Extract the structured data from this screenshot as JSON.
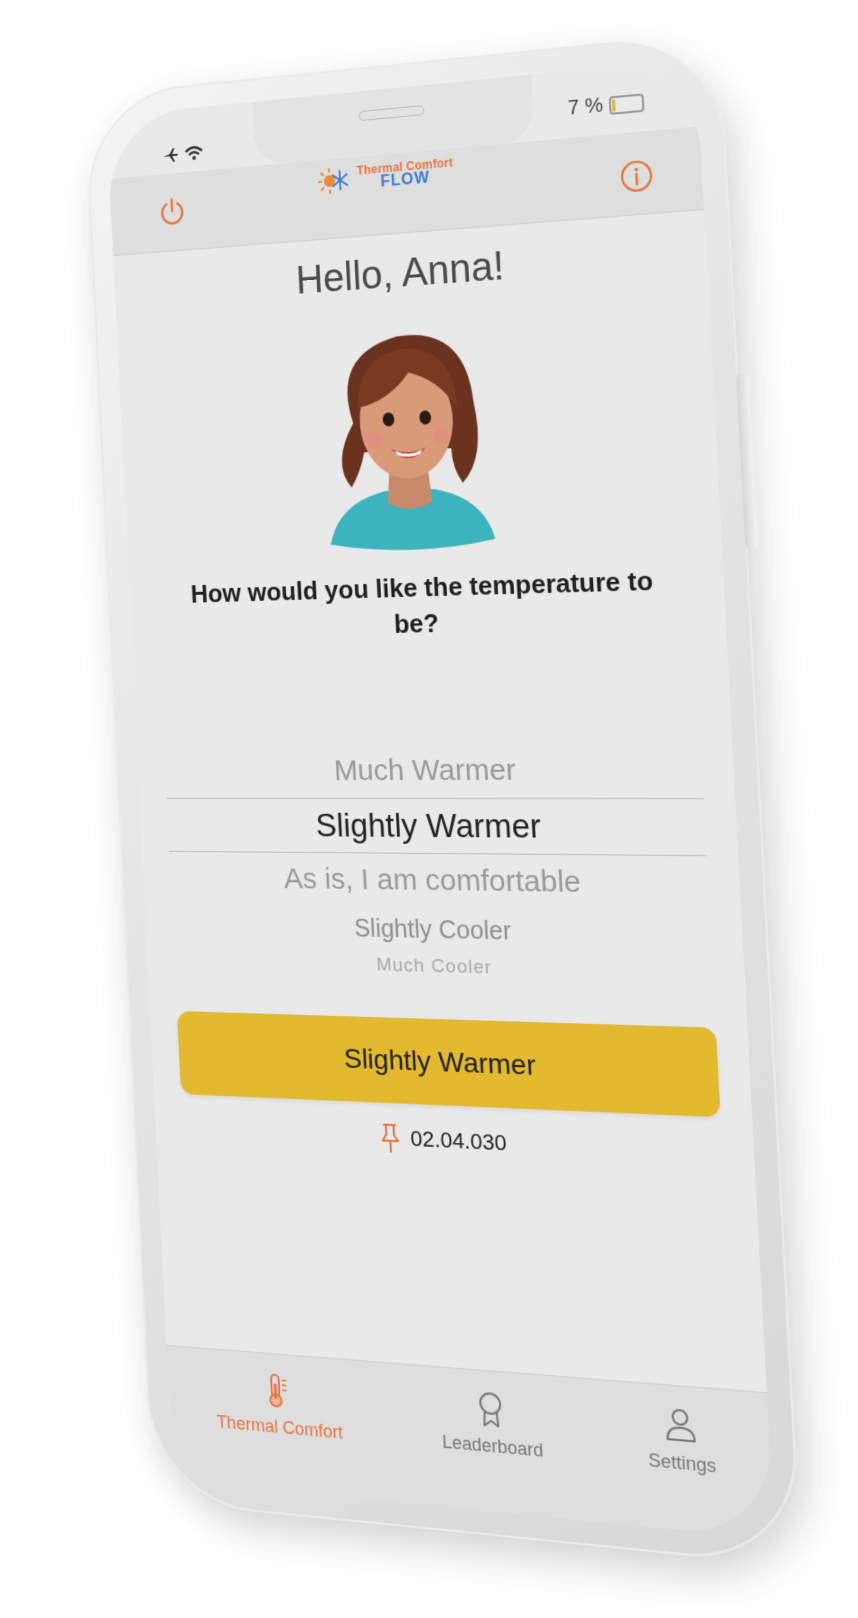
{
  "status_bar": {
    "battery_text": "7 %"
  },
  "header": {
    "logo_top": "Thermal Comfort",
    "logo_bottom": "FLOW",
    "power_icon": "power-icon",
    "info_icon": "info-icon"
  },
  "main": {
    "greeting": "Hello, Anna!",
    "question": "How would you like the temperature to be?",
    "picker_options": [
      "Much Warmer",
      "Slightly Warmer",
      "As is, I am comfortable",
      "Slightly Cooler",
      "Much Cooler"
    ],
    "selected_option": "Slightly Warmer",
    "submit_label": "Slightly Warmer",
    "location_code": "02.04.030"
  },
  "tabs": [
    {
      "label": "Thermal Comfort",
      "icon": "thermometer-icon",
      "active": true
    },
    {
      "label": "Leaderboard",
      "icon": "award-ribbon-icon",
      "active": false
    },
    {
      "label": "Settings",
      "icon": "person-icon",
      "active": false
    }
  ],
  "colors": {
    "accent": "#e6743e",
    "button": "#e3b92f",
    "logo_blue": "#3d7bd0",
    "background": "#e9e9e9"
  }
}
